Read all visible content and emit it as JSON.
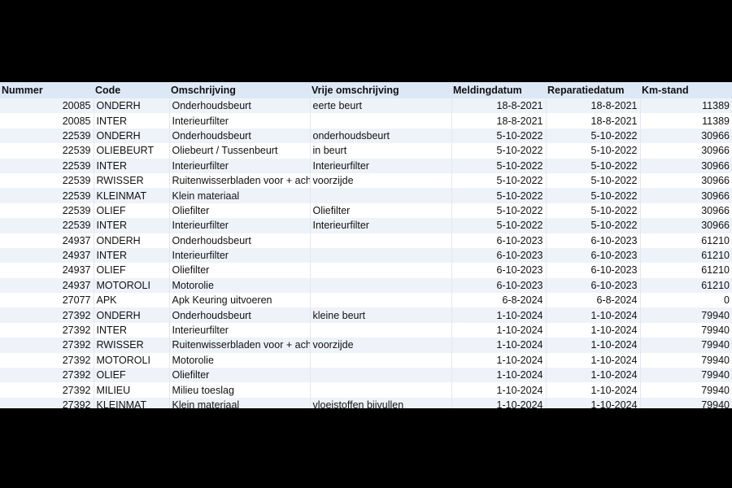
{
  "columns": [
    "Nummer",
    "Code",
    "Omschrijving",
    "Vrije omschrijving",
    "Meldingdatum",
    "Reparatiedatum",
    "Km-stand"
  ],
  "rows": [
    [
      "20085",
      "ONDERH",
      "Onderhoudsbeurt",
      "eerte beurt",
      "18-8-2021",
      "18-8-2021",
      "11389"
    ],
    [
      "20085",
      "INTER",
      "Interieurfilter",
      "",
      "18-8-2021",
      "18-8-2021",
      "11389"
    ],
    [
      "22539",
      "ONDERH",
      "Onderhoudsbeurt",
      "onderhoudsbeurt",
      "5-10-2022",
      "5-10-2022",
      "30966"
    ],
    [
      "22539",
      "OLIEBEURT",
      "Oliebeurt / Tussenbeurt",
      "in beurt",
      "5-10-2022",
      "5-10-2022",
      "30966"
    ],
    [
      "22539",
      "INTER",
      "Interieurfilter",
      "Interieurfilter",
      "5-10-2022",
      "5-10-2022",
      "30966"
    ],
    [
      "22539",
      "RWISSER",
      "Ruitenwisserbladen voor + achter",
      "voorzijde",
      "5-10-2022",
      "5-10-2022",
      "30966"
    ],
    [
      "22539",
      "KLEINMAT",
      "Klein materiaal",
      "",
      "5-10-2022",
      "5-10-2022",
      "30966"
    ],
    [
      "22539",
      "OLIEF",
      "Oliefilter",
      "Oliefilter",
      "5-10-2022",
      "5-10-2022",
      "30966"
    ],
    [
      "22539",
      "INTER",
      "Interieurfilter",
      "Interieurfilter",
      "5-10-2022",
      "5-10-2022",
      "30966"
    ],
    [
      "24937",
      "ONDERH",
      "Onderhoudsbeurt",
      "",
      "6-10-2023",
      "6-10-2023",
      "61210"
    ],
    [
      "24937",
      "INTER",
      "Interieurfilter",
      "",
      "6-10-2023",
      "6-10-2023",
      "61210"
    ],
    [
      "24937",
      "OLIEF",
      "Oliefilter",
      "",
      "6-10-2023",
      "6-10-2023",
      "61210"
    ],
    [
      "24937",
      "MOTOROLI",
      "Motorolie",
      "",
      "6-10-2023",
      "6-10-2023",
      "61210"
    ],
    [
      "27077",
      "APK",
      "Apk Keuring uitvoeren",
      "",
      "6-8-2024",
      "6-8-2024",
      "0"
    ],
    [
      "27392",
      "ONDERH",
      "Onderhoudsbeurt",
      "kleine beurt",
      "1-10-2024",
      "1-10-2024",
      "79940"
    ],
    [
      "27392",
      "INTER",
      "Interieurfilter",
      "",
      "1-10-2024",
      "1-10-2024",
      "79940"
    ],
    [
      "27392",
      "RWISSER",
      "Ruitenwisserbladen voor + achter",
      "voorzijde",
      "1-10-2024",
      "1-10-2024",
      "79940"
    ],
    [
      "27392",
      "MOTOROLI",
      "Motorolie",
      "",
      "1-10-2024",
      "1-10-2024",
      "79940"
    ],
    [
      "27392",
      "OLIEF",
      "Oliefilter",
      "",
      "1-10-2024",
      "1-10-2024",
      "79940"
    ],
    [
      "27392",
      "MILIEU",
      "Milieu toeslag",
      "",
      "1-10-2024",
      "1-10-2024",
      "79940"
    ],
    [
      "27392",
      "KLEINMAT",
      "Klein materiaal",
      "vloeistoffen bijvullen",
      "1-10-2024",
      "1-10-2024",
      "79940"
    ]
  ]
}
